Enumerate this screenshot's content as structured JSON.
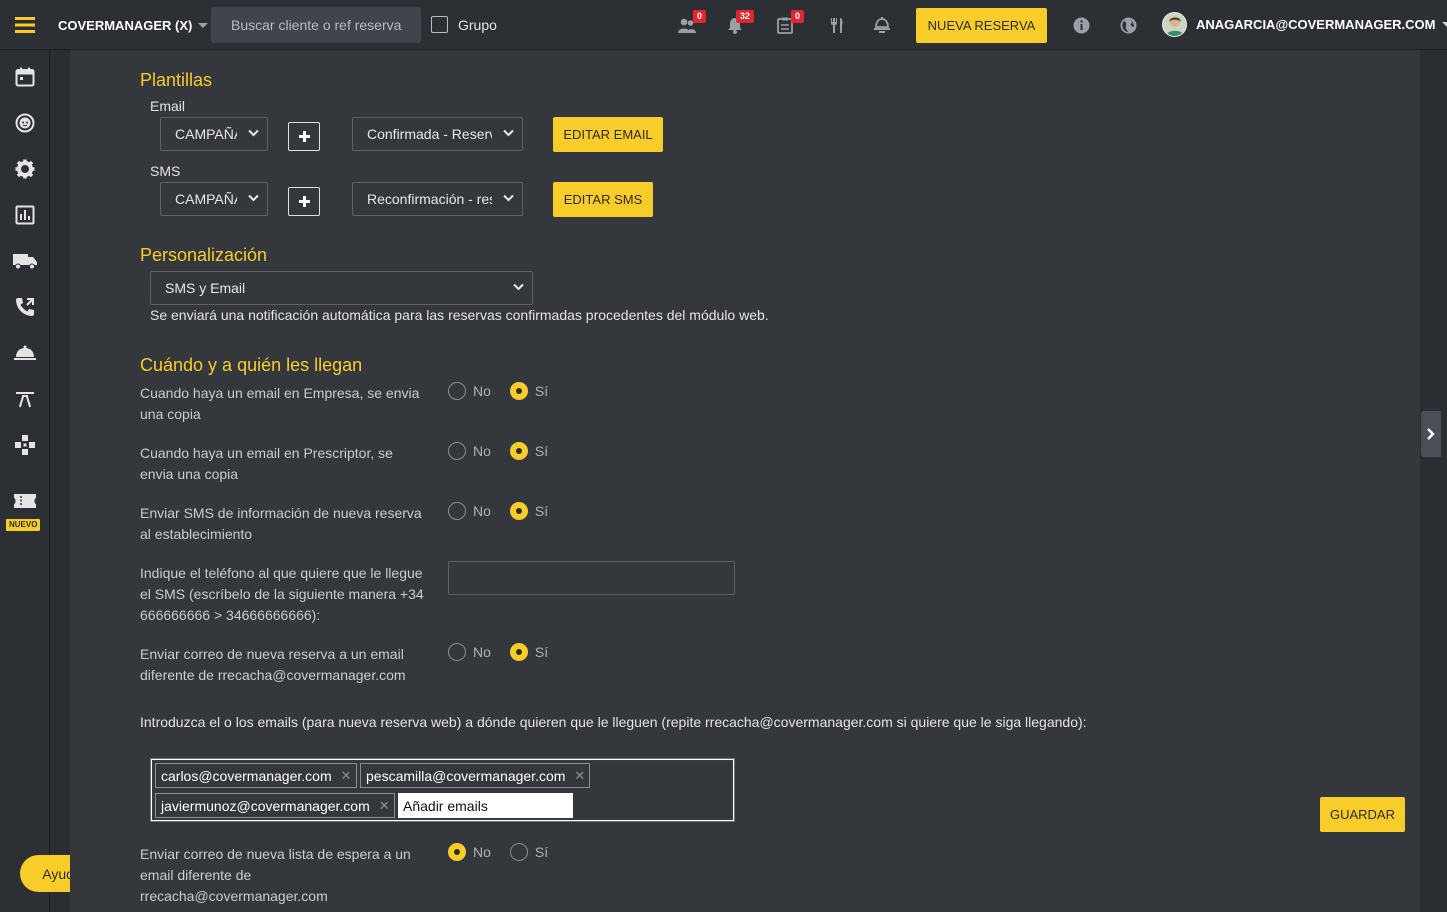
{
  "topbar": {
    "brand": "COVERMANAGER (X)",
    "search_placeholder": "Buscar cliente o ref reserva",
    "grupo_label": "Grupo",
    "badges": {
      "groups": "0",
      "notifications": "32",
      "tasks": "0"
    },
    "new_reservation": "NUEVA RESERVA",
    "user_email": "ANAGARCIA@COVERMANAGER.COM"
  },
  "sidebar": {
    "nuevo_badge": "NUEVO",
    "help": "Ayuda",
    "icons": [
      "calendar-icon",
      "face-icon",
      "settings-icon",
      "chart-icon",
      "truck-icon",
      "phone-icon",
      "cloche-icon",
      "table-icon",
      "gamepad-icon",
      "ticket-icon"
    ]
  },
  "templates": {
    "title": "Plantillas",
    "email_label": "Email",
    "email_campaign": "CAMPAÑA",
    "email_template": "Confirmada - Reserva",
    "edit_email": "EDITAR EMAIL",
    "sms_label": "SMS",
    "sms_campaign": "CAMPAÑA",
    "sms_template": "Reconfirmación - reserva",
    "edit_sms": "EDITAR SMS"
  },
  "personalization": {
    "title": "Personalización",
    "selected": "SMS y Email",
    "note": "Se enviará una notificación automática para las reservas confirmadas procedentes del módulo web."
  },
  "delivery": {
    "title": "Cuándo y a quién les llegan",
    "no": "No",
    "yes": "Sí",
    "q1": "Cuando haya un email en Empresa, se envia una copia",
    "q2": "Cuando haya un email en Prescriptor, se envia una copia",
    "q3": "Enviar SMS de información de nueva reserva al establecimiento",
    "q4": "Indique el teléfono al que quiere que le llegue el SMS (escríbelo de la siguiente manera +34 666666666 > 34666666666):",
    "q5": "Enviar correo de nueva reserva a un email diferente de rrecacha@covermanager.com",
    "emails_intro": "Introduzca el o los emails (para nueva reserva web) a dónde quieren que le lleguen (repite rrecacha@covermanager.com si quiere que le siga llegando):",
    "emails": [
      "carlos@covermanager.com",
      "pescamilla@covermanager.com",
      "javiermunoz@covermanager.com"
    ],
    "add_emails_placeholder": "Añadir emails",
    "save": "GUARDAR",
    "q6": "Enviar correo de nueva lista de espera a un email diferente de rrecacha@covermanager.com",
    "answers": {
      "q1": "Sí",
      "q2": "Sí",
      "q3": "Sí",
      "q5": "Sí",
      "q6": "No"
    }
  },
  "colors": {
    "accent": "#f8cd2a",
    "background": "#2a2e32",
    "panel": "#34383d"
  }
}
